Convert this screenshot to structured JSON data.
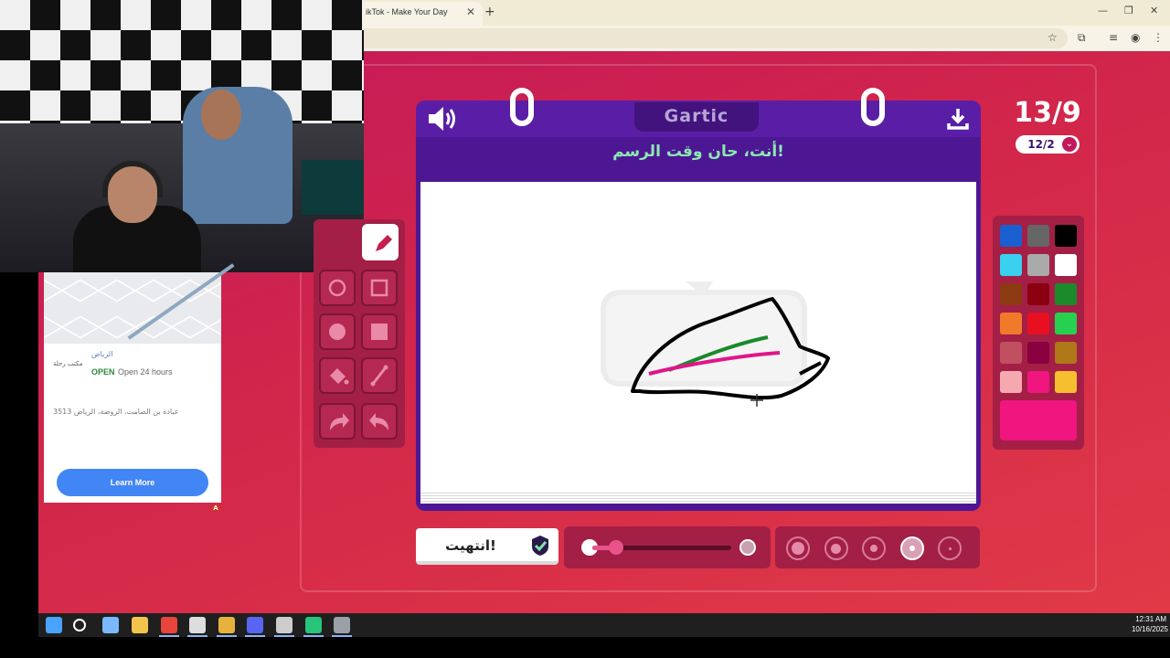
{
  "browser": {
    "tab_title": "ikTok - Make Your Day",
    "tab_close": "✕",
    "new_tab": "+",
    "minimize": "—",
    "restore": "❐",
    "close": "✕"
  },
  "ad": {
    "place_name": "الرياض",
    "logo_text": "مكتب رحلة",
    "status": "OPEN",
    "hours": "Open 24 hours",
    "address": "3513 عبادة بن الصامت، الروضة، الرياض",
    "cta": "Learn More",
    "badge": "A"
  },
  "game": {
    "logo": "Gartic",
    "prompt": "أنت، حان وقت الرسم!",
    "round": "13/9",
    "sub_round": "12/2",
    "done_label": "انتهيت!",
    "opacity_percent": 17,
    "selected_size_index": 3,
    "selected_tool": "pencil",
    "current_color": "#f0157f",
    "palette": [
      "#1a5fd0",
      "#666666",
      "#000000",
      "#3ad0f0",
      "#aaaaaa",
      "#ffffff",
      "#8b3a12",
      "#8b0010",
      "#1a8a2a",
      "#f07a2a",
      "#e81020",
      "#28d050",
      "#c05060",
      "#8a0040",
      "#b07818",
      "#f5a8b0",
      "#f0157f",
      "#f5c030"
    ],
    "tools": [
      "pencil",
      "circle-outline",
      "square-outline",
      "circle-filled",
      "square-filled",
      "fill-bucket",
      "line",
      "redo",
      "undo"
    ]
  },
  "taskbar": {
    "time": "12:31 AM",
    "date": "10/16/2025",
    "apps": [
      "start",
      "search",
      "copilot",
      "file-explorer",
      "chrome",
      "obs",
      "chrome-profile",
      "discord",
      "settings",
      "app-green",
      "shield"
    ]
  }
}
